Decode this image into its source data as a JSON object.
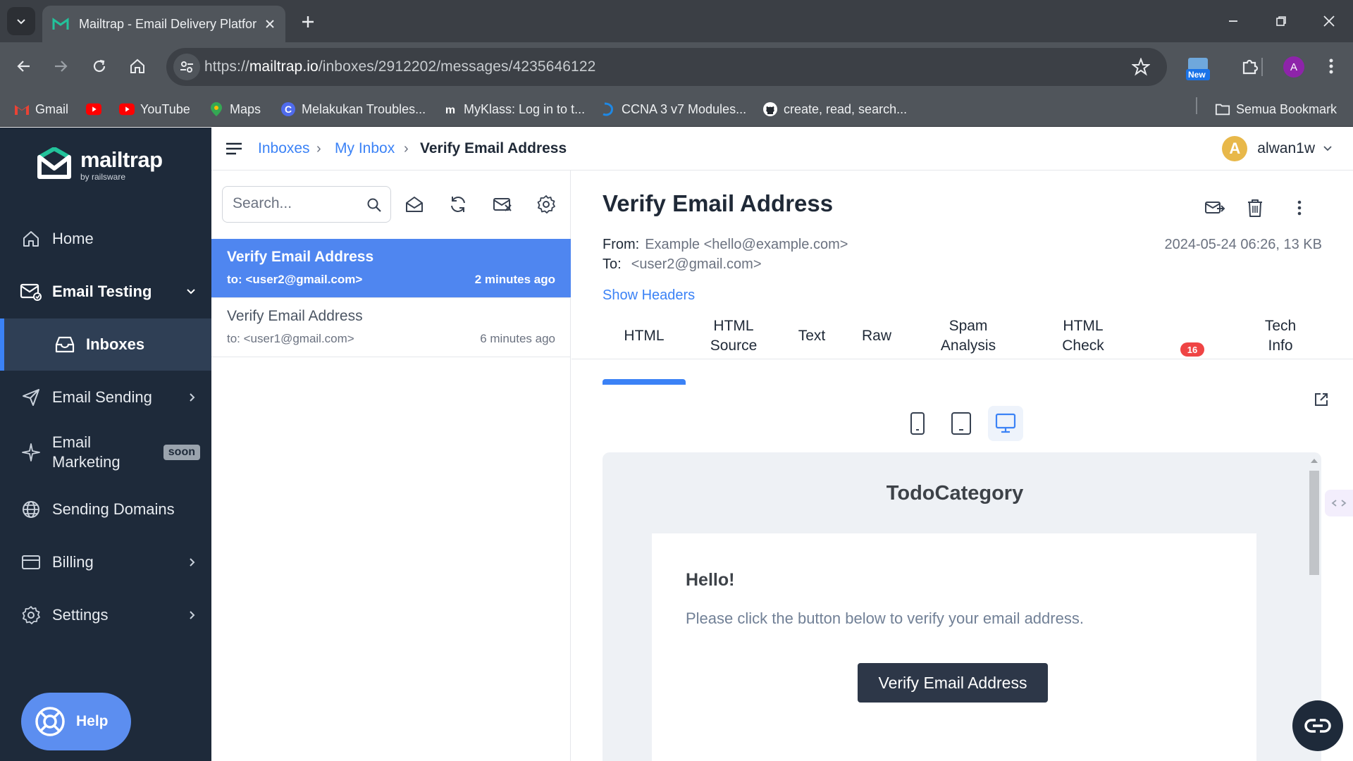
{
  "browser": {
    "tab_title": "Mailtrap - Email Delivery Platfor",
    "url_prefix": "https://",
    "url_host": "mailtrap.io",
    "url_path": "/inboxes/2912202/messages/4235646122",
    "new_badge": "New",
    "profile_initial": "A",
    "bookmarks": [
      {
        "label": "Gmail",
        "icon": "gmail-icon"
      },
      {
        "label": "",
        "icon": "youtube-icon"
      },
      {
        "label": "YouTube",
        "icon": "youtube-icon"
      },
      {
        "label": "Maps",
        "icon": "maps-icon"
      },
      {
        "label": "Melakukan Troubles...",
        "icon": "c-icon"
      },
      {
        "label": "MyKlass: Log in to t...",
        "icon": "myklass-icon"
      },
      {
        "label": "CCNA 3 v7 Modules...",
        "icon": "ccna-icon"
      },
      {
        "label": "create, read, search...",
        "icon": "github-icon"
      }
    ],
    "all_bookmarks": "Semua Bookmark"
  },
  "brand": {
    "name": "mailtrap",
    "sub": "by railsware"
  },
  "sidebar": {
    "items": [
      {
        "label": "Home",
        "icon": "home-icon"
      },
      {
        "label": "Email Testing",
        "icon": "email-testing-icon"
      },
      {
        "label": "Inboxes",
        "icon": "inbox-icon"
      },
      {
        "label": "Email Sending",
        "icon": "send-icon"
      },
      {
        "label": "Email\nMarketing",
        "line1": "Email",
        "line2": "Marketing",
        "icon": "sparkle-icon",
        "badge": "soon"
      },
      {
        "label": "Sending Domains",
        "icon": "globe-icon"
      },
      {
        "label": "Billing",
        "icon": "card-icon"
      },
      {
        "label": "Settings",
        "icon": "gear-icon"
      }
    ],
    "help": "Help"
  },
  "header": {
    "breadcrumb": [
      "Inboxes",
      "My Inbox",
      "Verify Email Address"
    ],
    "user": {
      "initial": "A",
      "name": "alwan1w"
    }
  },
  "list": {
    "search_placeholder": "Search...",
    "messages": [
      {
        "subject": "Verify Email Address",
        "to": "to: <user2@gmail.com>",
        "time": "2 minutes ago",
        "selected": true
      },
      {
        "subject": "Verify Email Address",
        "to": "to: <user1@gmail.com>",
        "time": "6 minutes ago",
        "selected": false
      }
    ]
  },
  "message": {
    "subject": "Verify Email Address",
    "from_label": "From:",
    "from_value": "Example <hello@example.com>",
    "to_label": "To:",
    "to_value": "<user2@gmail.com>",
    "date_size": "2024-05-24 06:26, 13 KB",
    "show_headers": "Show Headers",
    "tabs": [
      {
        "line1": "HTML",
        "line2": ""
      },
      {
        "line1": "HTML",
        "line2": "Source"
      },
      {
        "line1": "Text",
        "line2": ""
      },
      {
        "line1": "Raw",
        "line2": ""
      },
      {
        "line1": "Spam",
        "line2": "Analysis"
      },
      {
        "line1": "HTML",
        "line2": "Check"
      },
      {
        "line1": "Tech",
        "line2": "Info"
      }
    ],
    "html_check_badge": "16",
    "active_tab": "HTML",
    "active_device": "desktop"
  },
  "preview": {
    "brand": "TodoCategory",
    "greeting": "Hello!",
    "body": "Please click the button below to verify your email address.",
    "button": "Verify Email Address"
  }
}
